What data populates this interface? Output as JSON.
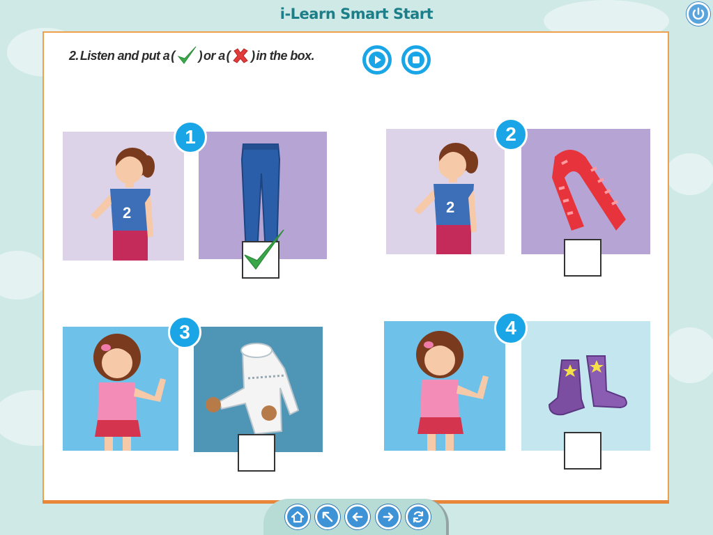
{
  "app": {
    "title": "i-Learn Smart Start"
  },
  "instruction": {
    "number": "2.",
    "text_before": "Listen and put a",
    "text_middle": "or a",
    "text_after": "in the box."
  },
  "items": [
    {
      "number": "1",
      "garment": "jeans",
      "checked": true
    },
    {
      "number": "2",
      "garment": "scarf",
      "checked": false
    },
    {
      "number": "3",
      "garment": "sweater",
      "checked": false
    },
    {
      "number": "4",
      "garment": "boots",
      "checked": false
    }
  ],
  "colors": {
    "accent_blue": "#1aa6e6",
    "title_teal": "#1b7e88",
    "panel_border": "#f0a04b",
    "check_green": "#3aa84a",
    "cross_red": "#e23b3b"
  },
  "nav": [
    "home-icon",
    "expand-icon",
    "back-icon",
    "forward-icon",
    "refresh-icon"
  ]
}
